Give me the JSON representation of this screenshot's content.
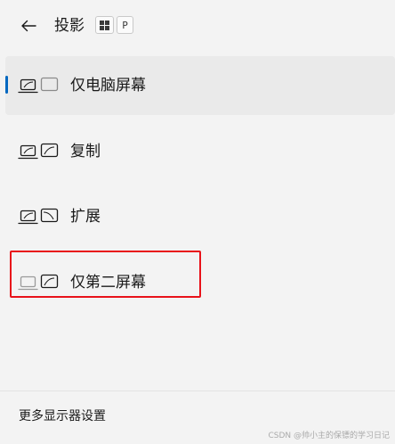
{
  "header": {
    "title": "投影",
    "shortcut_key": "P"
  },
  "options": [
    {
      "label": "仅电脑屏幕",
      "selected": true,
      "icon": "pc-screen-only-icon"
    },
    {
      "label": "复制",
      "selected": false,
      "icon": "duplicate-icon"
    },
    {
      "label": "扩展",
      "selected": false,
      "icon": "extend-icon"
    },
    {
      "label": "仅第二屏幕",
      "selected": false,
      "icon": "second-screen-only-icon"
    }
  ],
  "footer": {
    "link": "更多显示器设置"
  },
  "watermark": "CSDN @帅小主的保镖的学习日记",
  "colors": {
    "accent": "#0067c0",
    "highlight": "#e8121a",
    "background": "#f3f3f3"
  }
}
